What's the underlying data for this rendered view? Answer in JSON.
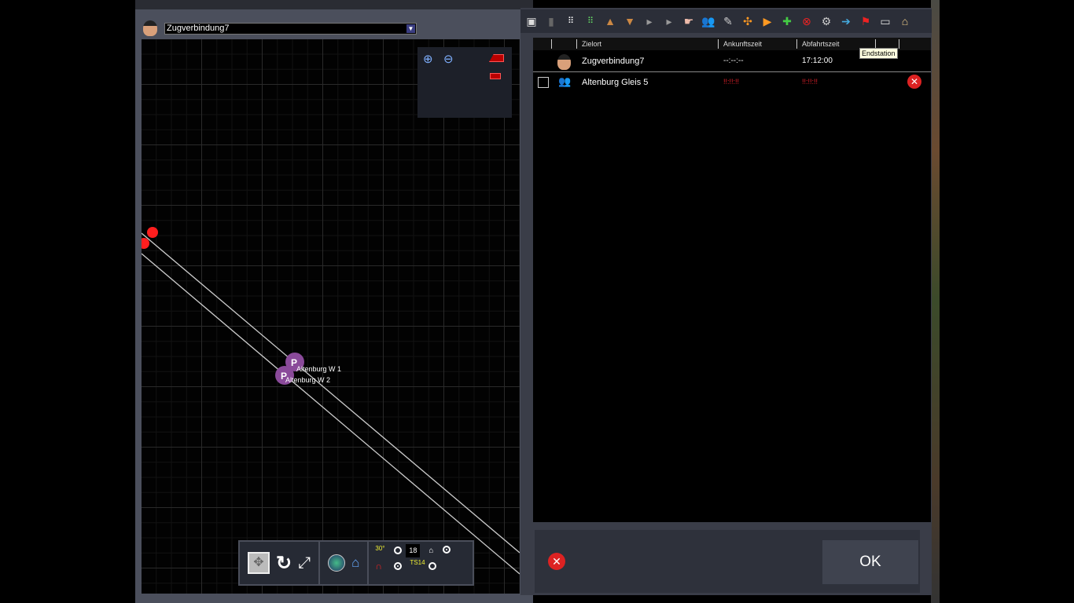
{
  "left_panel": {
    "train_select": "Zugverbindung7",
    "stations": [
      "Altenburg W 1",
      "Altenburg W 2"
    ]
  },
  "toolbar": {
    "icons": [
      "save-icon",
      "trash-icon",
      "grid-white-icon",
      "grid-green-icon",
      "move-up-icon",
      "move-down-icon",
      "insert-after-icon",
      "insert-before-icon",
      "pointer-hand-icon",
      "passengers-icon",
      "signal-box-icon",
      "expand-icon",
      "add-play-icon",
      "add-next-icon",
      "remove-stop-icon",
      "settings-doc-icon",
      "enter-icon",
      "flag-icon",
      "platform-icon",
      "station-roof-icon"
    ]
  },
  "table": {
    "headers": [
      "",
      "",
      "Zielort",
      "Ankunftszeit",
      "Abfahrtszeit",
      "",
      ""
    ],
    "rows": [
      {
        "name": "Zugverbindung7",
        "arrival": "--:--:--",
        "departure": "17:12:00"
      },
      {
        "name": "Altenburg Gleis 5",
        "arrival": "!!:!!:!!",
        "departure": "!!:!!:!!"
      }
    ],
    "tooltip": "Endstation"
  },
  "bottom": {
    "ok": "OK"
  },
  "map_tools": {
    "speed_value": "18",
    "angle_label": "30°",
    "ts_label": "TS14"
  },
  "colors": {
    "error": "#e0202a",
    "marker": "#8a4a9a",
    "accent_red": "#ff2020"
  }
}
